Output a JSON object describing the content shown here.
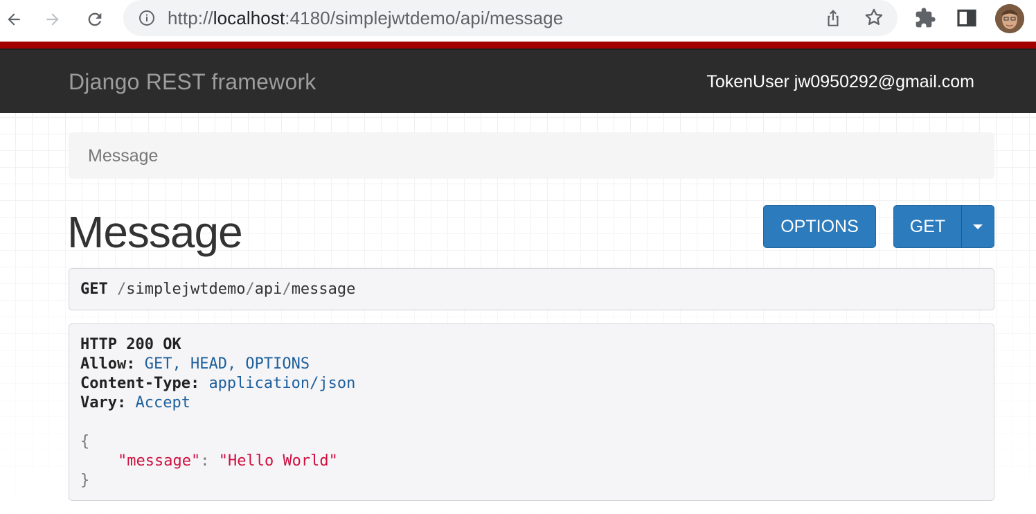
{
  "browser": {
    "url_prefix": "http://",
    "url_host": "localhost",
    "url_rest": ":4180/simplejwtdemo/api/message",
    "icons": [
      "back-arrow-icon",
      "forward-arrow-icon",
      "reload-icon",
      "info-icon",
      "share-icon",
      "star-icon",
      "extensions-icon",
      "side-panel-icon"
    ]
  },
  "navbar": {
    "brand": "Django REST framework",
    "user": "TokenUser jw0950292@gmail.com"
  },
  "breadcrumb": {
    "current": "Message"
  },
  "page": {
    "title": "Message",
    "options_label": "OPTIONS",
    "get_label": "GET"
  },
  "request": {
    "method": "GET",
    "path_parts": [
      "simplejwtdemo",
      "api",
      "message"
    ]
  },
  "response": {
    "status": "HTTP 200 OK",
    "headers": [
      {
        "name": "Allow:",
        "value": "GET, HEAD, OPTIONS"
      },
      {
        "name": "Content-Type:",
        "value": "application/json"
      },
      {
        "name": "Vary:",
        "value": "Accept"
      }
    ],
    "body": {
      "open": "{",
      "key": "\"message\"",
      "colon": ":",
      "value": "\"Hello World\"",
      "close": "}"
    }
  },
  "colors": {
    "navbar_bg": "#2c2c2c",
    "accent_stripe": "#a30000",
    "button_blue": "#2c7bbd",
    "header_value": "#1d5f9c",
    "json_string": "#d01040"
  }
}
